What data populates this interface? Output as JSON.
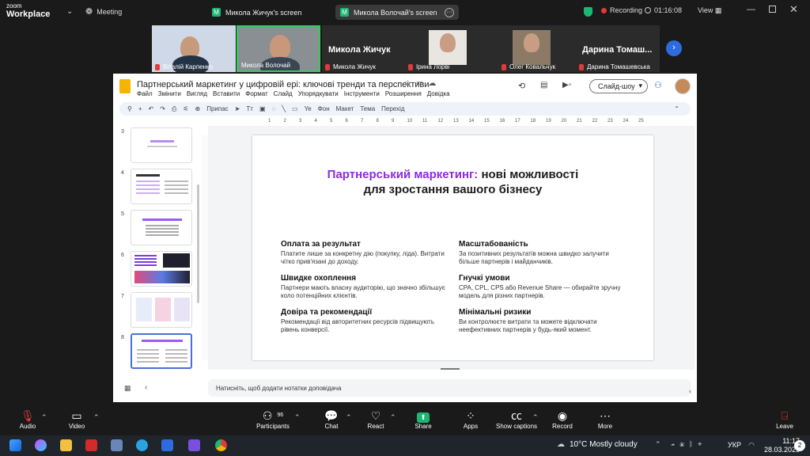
{
  "zoom": {
    "brand_top": "zoom",
    "brand_bottom": "Workplace",
    "meeting_label": "Meeting",
    "screens": [
      "Микола Жичук's screen",
      "Микола Волочай's screen"
    ],
    "recording_label": "Recording",
    "timer": "01:16:08",
    "view_label": "View"
  },
  "participants": [
    {
      "name": "Віталій Карпенко"
    },
    {
      "name": "Микола Волочай"
    },
    {
      "name": "Микола Жичук",
      "big": "Микола Жичук"
    },
    {
      "name": "Ірина Лорві"
    },
    {
      "name": "Олег Ковальчук"
    },
    {
      "name": "Дарина Томашевська",
      "big": "Дарина Томаш..."
    }
  ],
  "slides_app": {
    "title": "Партнерський маркетинг у цифровій ері: ключові тренди та перспективи",
    "menu": [
      "Файл",
      "Змінити",
      "Вигляд",
      "Вставити",
      "Формат",
      "Слайд",
      "Упорядкувати",
      "Інструменти",
      "Розширення",
      "Довідка"
    ],
    "toolbar": {
      "fit": "Припас",
      "bg": "Фон",
      "layout": "Макет",
      "theme": "Тема",
      "transition": "Перехід"
    },
    "slideshow": "Слайд-шоу",
    "thumb_numbers": [
      "3",
      "4",
      "5",
      "6",
      "7",
      "8"
    ],
    "ruler_marks": [
      "1",
      "2",
      "3",
      "4",
      "5",
      "6",
      "7",
      "8",
      "9",
      "10",
      "11",
      "12",
      "13",
      "14",
      "15",
      "16",
      "17",
      "18",
      "19",
      "20",
      "21",
      "22",
      "23",
      "24",
      "25"
    ],
    "notes_placeholder": "Натисніть, щоб додати нотатки доповідача"
  },
  "slide": {
    "title_accent": "Партнерський маркетинг:",
    "title_rest": " нові можливості",
    "title_line2": "для зростання вашого бізнесу",
    "items": [
      {
        "h": "Оплата за результат",
        "p": "Платите лише за конкретну дію (покупку, ліда). Витрати чітко прив'язані до доходу."
      },
      {
        "h": "Масштабованість",
        "p": "За позитивних результатів можна швидко залучити більше партнерів і майданчиків."
      },
      {
        "h": "Швидке охоплення",
        "p": "Партнери мають власну аудиторію, що значно збільшує коло потенційних клієнтів."
      },
      {
        "h": "Гнучкі умови",
        "p": "CPA, CPL, CPS або Revenue Share — обирайте зручну модель для різних партнерів."
      },
      {
        "h": "Довіра та рекомендації",
        "p": "Рекомендації від авторитетних ресурсів підвищують рівень конверсії."
      },
      {
        "h": "Мінімальні ризики",
        "p": "Ви контролюєте витрати та можете відключати неефективних партнерів у будь-який момент."
      }
    ]
  },
  "controls": {
    "audio": "Audio",
    "video": "Video",
    "participants": "Participants",
    "participants_count": "96",
    "chat": "Chat",
    "react": "React",
    "share": "Share",
    "apps": "Apps",
    "captions": "Show captions",
    "record": "Record",
    "more": "More",
    "leave": "Leave"
  },
  "taskbar": {
    "weather": "10°C  Mostly cloudy",
    "lang": "УКР",
    "time": "11:17",
    "date": "28.03.2025",
    "notifications": "2"
  }
}
